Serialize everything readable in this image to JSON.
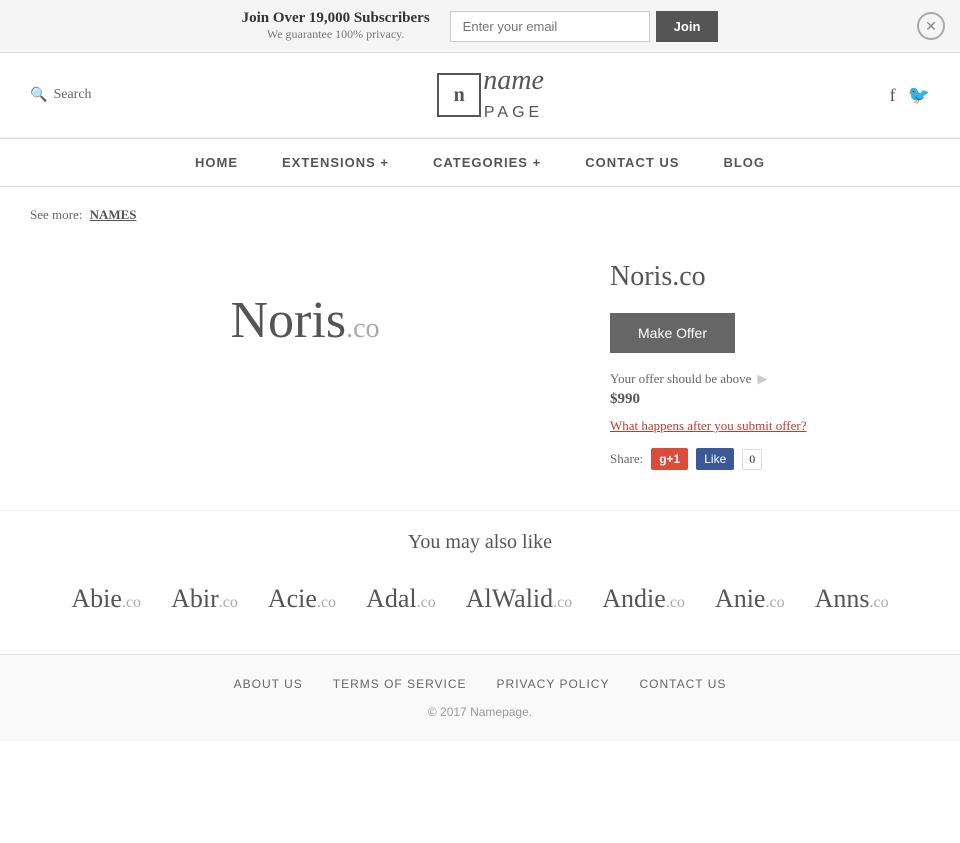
{
  "banner": {
    "title": "Join Over 19,000 Subscribers",
    "subtitle": "We guarantee 100% privacy.",
    "email_placeholder": "Enter your email",
    "join_label": "Join"
  },
  "header": {
    "search_label": "Search",
    "logo_icon": "n",
    "logo_name": "name",
    "logo_page": "PAGE",
    "facebook_label": "Facebook",
    "twitter_label": "Twitter"
  },
  "nav": {
    "items": [
      {
        "label": "HOME",
        "href": "#"
      },
      {
        "label": "EXTENSIONS +",
        "href": "#"
      },
      {
        "label": "CATEGORIES +",
        "href": "#"
      },
      {
        "label": "CONTACT US",
        "href": "#"
      },
      {
        "label": "BLOG",
        "href": "#"
      }
    ]
  },
  "breadcrumb": {
    "prefix": "See more:",
    "link_label": "NAMES"
  },
  "domain": {
    "name": "Noris",
    "tld": ".co",
    "full": "Noris.co",
    "make_offer_label": "Make Offer",
    "offer_note": "Your offer should be above",
    "offer_amount": "$990",
    "what_happens_label": "What happens after you submit offer?",
    "share_label": "Share:",
    "gplus_label": "g+1",
    "fb_like_label": "Like",
    "fb_count": "0"
  },
  "also_like": {
    "heading": "You may also like",
    "domains": [
      {
        "name": "Abie",
        "tld": ".co"
      },
      {
        "name": "Abir",
        "tld": ".co"
      },
      {
        "name": "Acie",
        "tld": ".co"
      },
      {
        "name": "Adal",
        "tld": ".co"
      },
      {
        "name": "AlWalid",
        "tld": ".co"
      },
      {
        "name": "Andie",
        "tld": ".co"
      },
      {
        "name": "Anie",
        "tld": ".co"
      },
      {
        "name": "Anns",
        "tld": ".co"
      }
    ]
  },
  "footer": {
    "links": [
      {
        "label": "ABOUT US",
        "href": "#"
      },
      {
        "label": "TERMS OF SERVICE",
        "href": "#"
      },
      {
        "label": "PRIVACY POLICY",
        "href": "#"
      },
      {
        "label": "CONTACT US",
        "href": "#"
      }
    ],
    "copyright": "© 2017",
    "brand": "Namepage."
  }
}
